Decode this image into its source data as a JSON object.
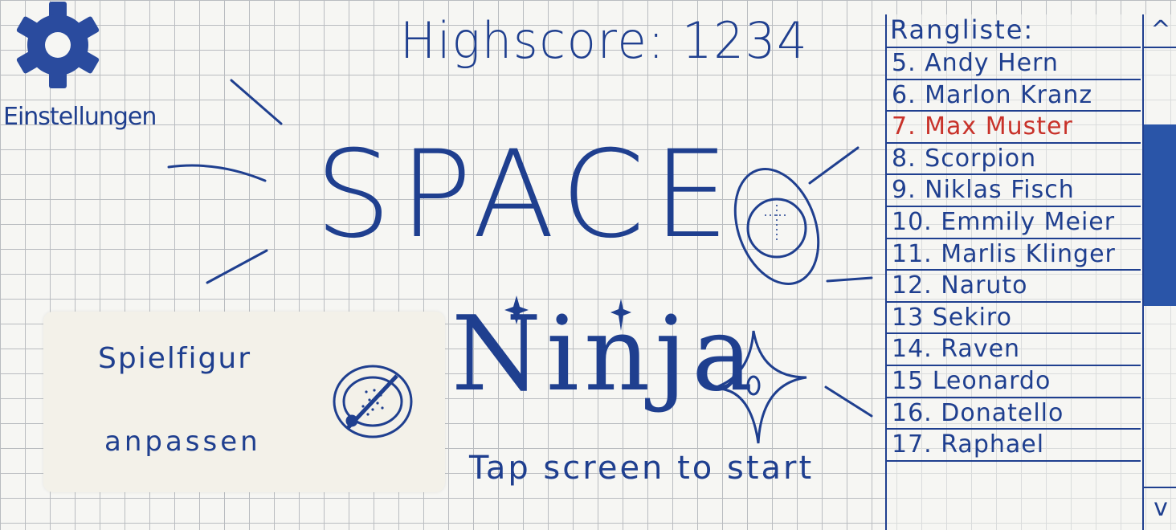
{
  "settings": {
    "label": "Einstellungen",
    "icon": "gear-icon"
  },
  "highscore": {
    "text": "Highscore: 1234"
  },
  "title": {
    "line1": "SPACE",
    "line2": "Ninja"
  },
  "start_hint": "Tap screen to start",
  "character": {
    "line1": "Spielfigur",
    "line2": "anpassen",
    "icon": "character-face-icon"
  },
  "leaderboard": {
    "title": "Rangliste:",
    "entries": [
      "5. Andy Hern",
      "6. Marlon Kranz",
      "7. Max Muster",
      "8. Scorpion",
      "9. Niklas Fisch",
      "10. Emmily Meier",
      "11. Marlis Klinger",
      "12. Naruto",
      "13 Sekiro",
      "14. Raven",
      "15 Leonardo",
      "16. Donatello",
      "17. Raphael"
    ],
    "highlight_index": 2,
    "highlight_color": "#c8322a",
    "scroll_up": "^",
    "scroll_down": "v",
    "scroll_position": 0.3
  },
  "colors": {
    "ink": "#1f3f8f",
    "paper": "#f6f6f3",
    "grid": "#b9bcc0",
    "thumb": "#2a55a8"
  }
}
